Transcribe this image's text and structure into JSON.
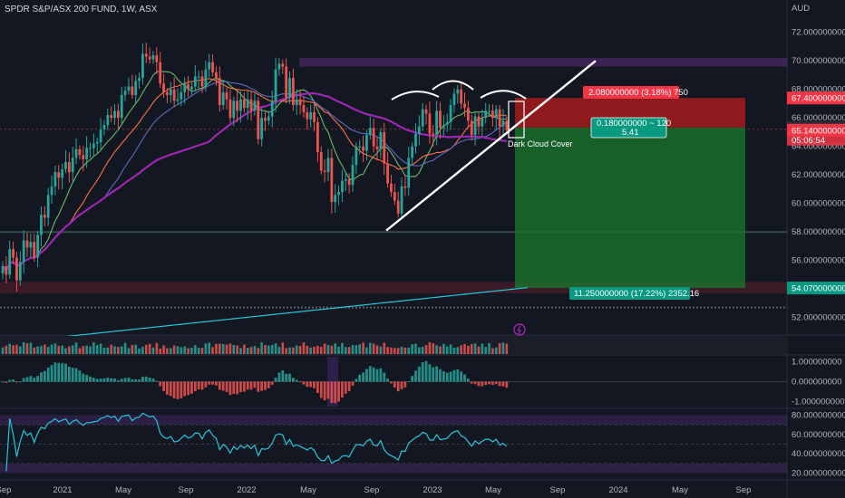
{
  "colors": {
    "background": "#131722",
    "up": "#26a69a",
    "down": "#ef5350",
    "grid": "#1e222d",
    "ma_green": "#66bb6a",
    "ma_orange": "#ff7043",
    "ma_blue": "#5c6bc0",
    "ma_purple": "#9c27b0",
    "ma_cyan": "#26c6da",
    "loss_zone": "#b71c1c",
    "profit_zone": "#1b7a2e",
    "rsi_line": "#26c6da",
    "rsi_band": "#4a2a6e"
  },
  "chart_data": {
    "type": "candlestick",
    "title": "SPDR S&P/ASX 200 FUND, 1W, ASX",
    "currency": "AUD",
    "interval": "1W",
    "x_axis": {
      "tick_labels": [
        "Sep",
        "2021",
        "May",
        "Sep",
        "2022",
        "May",
        "Sep",
        "2023",
        "May",
        "Sep",
        "2024",
        "May",
        "Sep"
      ],
      "range_weeks": [
        0,
        210
      ]
    },
    "price_axis": {
      "ylim": [
        50.9,
        73.0
      ],
      "tick_labels": [
        "72.000000000",
        "70.000000000",
        "68.000000000",
        "66.000000000",
        "64.000000000",
        "62.000000000",
        "60.000000000",
        "58.000000000",
        "56.000000000",
        "54.000000000",
        "52.000000000"
      ],
      "tick_values": [
        72,
        70,
        68,
        66,
        64,
        62,
        60,
        58,
        56,
        54,
        52
      ]
    },
    "closes": [
      55.6,
      55.0,
      56.8,
      56.2,
      54.6,
      55.9,
      57.4,
      56.9,
      57.3,
      56.2,
      57.8,
      59.2,
      59.0,
      60.6,
      61.2,
      62.2,
      61.8,
      62.4,
      62.9,
      62.2,
      63.2,
      63.8,
      63.4,
      63.1,
      63.9,
      63.9,
      64.2,
      64.3,
      65.2,
      65.5,
      66.2,
      66.0,
      66.5,
      66.0,
      67.6,
      67.9,
      68.2,
      67.6,
      68.6,
      68.8,
      70.5,
      70.3,
      70.1,
      70.4,
      69.9,
      68.4,
      67.8,
      67.6,
      68.0,
      67.2,
      67.3,
      67.8,
      68.4,
      68.0,
      68.2,
      68.9,
      68.9,
      68.2,
      69.4,
      69.9,
      69.2,
      68.8,
      66.9,
      67.8,
      67.3,
      66.0,
      67.2,
      66.5,
      67.3,
      66.7,
      67.3,
      66.5,
      67.2,
      64.5,
      66.0,
      65.8,
      66.1,
      67.2,
      69.4,
      69.8,
      69.6,
      67.4,
      68.8,
      66.9,
      67.3,
      66.9,
      66.4,
      65.9,
      66.4,
      65.7,
      63.6,
      62.3,
      62.2,
      63.2,
      60.1,
      60.6,
      60.8,
      61.6,
      61.7,
      61.3,
      62.7,
      64.0,
      64.0,
      63.7,
      64.8,
      65.3,
      64.0,
      63.8,
      65.0,
      62.8,
      61.4,
      60.8,
      60.2,
      59.3,
      61.2,
      61.1,
      63.2,
      64.0,
      64.9,
      65.4,
      66.6,
      66.3,
      64.9,
      64.8,
      66.5,
      65.3,
      65.5,
      65.7,
      66.9,
      67.7,
      68.0,
      67.0,
      66.7,
      65.8,
      64.8,
      66.1,
      65.4,
      66.0,
      66.5,
      66.5,
      66.0,
      66.6,
      65.4,
      65.8,
      65.14
    ],
    "current_price": 65.14,
    "countdown": "05:06:54",
    "price_tags": [
      "67.400000000",
      "65.320000000",
      "65.140000000",
      "54.070000000"
    ],
    "price_tag_values": [
      67.4,
      65.32,
      65.14,
      54.07
    ],
    "moving_averages": [
      {
        "color": "#66bb6a",
        "period": 10
      },
      {
        "color": "#ff7043",
        "period": 20
      },
      {
        "color": "#5c6bc0",
        "period": 30
      },
      {
        "color": "#9c27b0",
        "period": 60
      },
      {
        "color": "#26c6da",
        "period": 100
      }
    ],
    "annotations": [
      {
        "text": "Dark Cloud Cover"
      }
    ],
    "position": {
      "type": "short",
      "entry": 65.32,
      "stop": 67.4,
      "target": 54.07,
      "stop_label": "2.080000000 (3.18%) 750",
      "target_label": "11.250000000 (17.22%) 2352.16",
      "center_label_1": "0.180000000 ~ 120",
      "center_label_2": "5.41"
    },
    "oscillator": {
      "tick_labels": [
        "1.000000000",
        "0.000000000",
        "-1.000000000"
      ],
      "tick_values": [
        1,
        0,
        -1
      ]
    },
    "rsi": {
      "tick_labels": [
        "80.000000000",
        "60.000000000",
        "40.000000000",
        "20.000000000"
      ],
      "tick_values": [
        80,
        60,
        40,
        20
      ]
    }
  }
}
